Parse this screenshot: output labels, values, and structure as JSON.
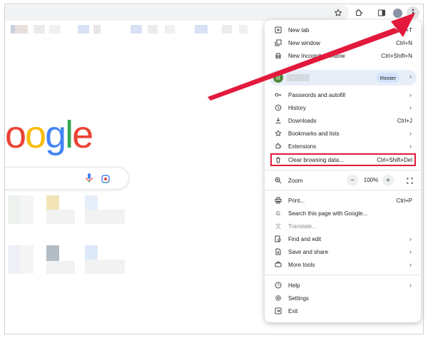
{
  "browser": {
    "toolbar_icons": [
      "star-icon",
      "extensions-icon",
      "side-panel-icon",
      "profile-avatar",
      "kebab-menu-icon"
    ]
  },
  "google": {
    "logo_text": "oogle",
    "logo_colors": {
      "o1": "#ea4335",
      "o2": "#fbbc05",
      "g": "#4285f4",
      "l": "#34a853",
      "e": "#ea4335"
    }
  },
  "profile": {
    "initial": "R",
    "badge": "Rexter"
  },
  "menu": {
    "new_tab": {
      "label": "New tab",
      "shortcut": "Ctrl+T"
    },
    "new_window": {
      "label": "New window",
      "shortcut": "Ctrl+N"
    },
    "new_incognito": {
      "label": "New Incognito window",
      "shortcut": "Ctrl+Shift+N"
    },
    "passwords": {
      "label": "Passwords and autofill"
    },
    "history": {
      "label": "History"
    },
    "downloads": {
      "label": "Downloads",
      "shortcut": "Ctrl+J"
    },
    "bookmarks": {
      "label": "Bookmarks and lists"
    },
    "extensions": {
      "label": "Extensions"
    },
    "clear_data": {
      "label": "Clear browsing data...",
      "shortcut": "Ctrl+Shift+Del"
    },
    "zoom": {
      "label": "Zoom",
      "minus": "−",
      "value": "100%",
      "plus": "+"
    },
    "print": {
      "label": "Print...",
      "shortcut": "Ctrl+P"
    },
    "search_page": {
      "label": "Search this page with Google..."
    },
    "translate": {
      "label": "Translate..."
    },
    "find_edit": {
      "label": "Find and edit"
    },
    "save_share": {
      "label": "Save and share"
    },
    "more_tools": {
      "label": "More tools"
    },
    "help": {
      "label": "Help"
    },
    "settings": {
      "label": "Settings"
    },
    "exit": {
      "label": "Exit"
    }
  },
  "colors": {
    "annotation_red": "#e2193c",
    "profile_bg": "#e8eef8",
    "badge_bg": "#d3e3fd"
  }
}
